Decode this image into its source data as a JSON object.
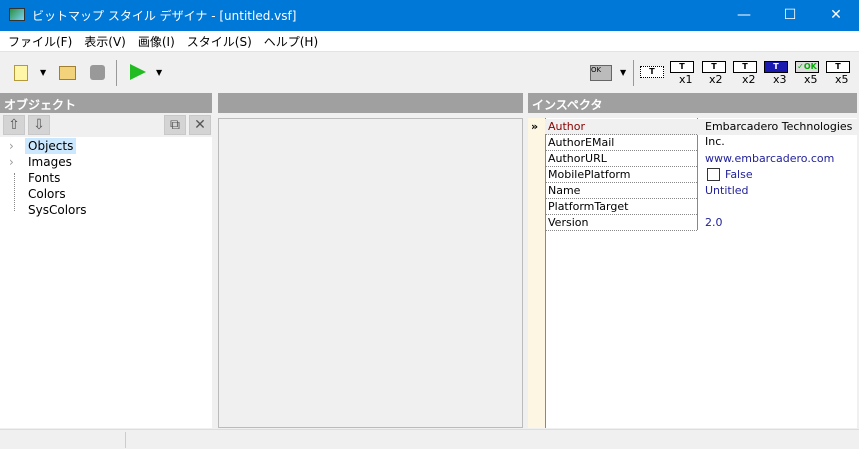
{
  "window": {
    "title": "ビットマップ スタイル デザイナ - [untitled.vsf]",
    "minimize": "—",
    "maximize": "☐",
    "close": "✕"
  },
  "menu": [
    "ファイル(F)",
    "表示(V)",
    "画像(I)",
    "スタイル(S)",
    "ヘルプ(H)"
  ],
  "toolbar": {
    "device_labels": [
      "T",
      "T",
      "T",
      "T",
      "✓OK",
      "T"
    ],
    "multipliers": [
      "x1",
      "x2",
      "x2",
      "x3",
      "x5",
      "x5"
    ]
  },
  "objects_panel": {
    "title": "オブジェクト",
    "tree": [
      "Objects",
      "Images",
      "Fonts",
      "Colors",
      "SysColors"
    ]
  },
  "inspector": {
    "title": "インスペクタ",
    "rows": [
      {
        "name": "Author",
        "value": "Embarcadero Technologies Inc."
      },
      {
        "name": "AuthorEMail",
        "value": ""
      },
      {
        "name": "AuthorURL",
        "value": "www.embarcadero.com"
      },
      {
        "name": "MobilePlatform",
        "value": "False"
      },
      {
        "name": "Name",
        "value": "Untitled"
      },
      {
        "name": "PlatformTarget",
        "value": ""
      },
      {
        "name": "Version",
        "value": "2.0"
      }
    ]
  }
}
